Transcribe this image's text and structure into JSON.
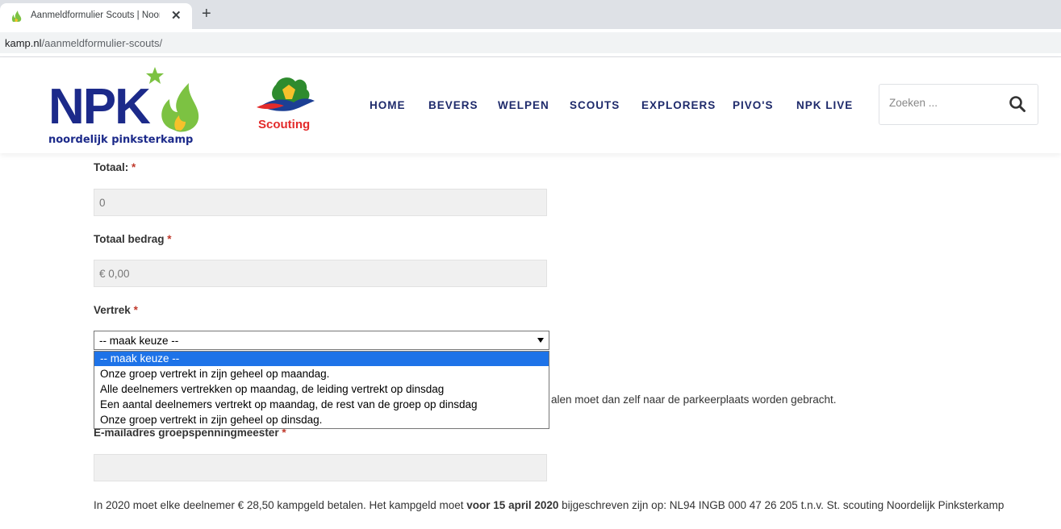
{
  "browser": {
    "tab_title": "Aanmeldformulier Scouts | Noord",
    "close_label": "✕",
    "new_tab_label": "+",
    "url_domain": "kamp.nl",
    "url_path": "/aanmeldformulier-scouts/"
  },
  "header": {
    "logo_text": "NPK",
    "logo_subtext": "noordelijk pinksterkamp",
    "scouting_logo_text": "Scouting",
    "nav": [
      "HOME",
      "BEVERS",
      "WELPEN",
      "SCOUTS",
      "EXPLORERS",
      "PIVO'S",
      "NPK LIVE"
    ],
    "search_placeholder": "Zoeken ..."
  },
  "form": {
    "totaal_label": "Totaal:",
    "totaal_value": "0",
    "bedrag_label": "Totaal bedrag",
    "bedrag_value": "€ 0,00",
    "vertrek_label": "Vertrek",
    "vertrek_selected": "-- maak keuze --",
    "vertrek_options": [
      "-- maak keuze --",
      "Onze groep vertrekt in zijn geheel op maandag.",
      "Alle deelnemers vertrekken op maandag, de leiding vertrekt op dinsdag",
      "Een aantal deelnemers vertrekt op maandag, de rest van de groep op dinsdag",
      "Onze groep vertrekt in zijn geheel op dinsdag."
    ],
    "hint_partial": "alen moet dan zelf naar de parkeerplaats worden gebracht.",
    "email_label": "E-mailadres groepspenningmeester",
    "email_value": "",
    "required_mark": "*"
  },
  "info": {
    "text_before": "In 2020 moet elke deelnemer € 28,50 kampgeld betalen. Het kampgeld moet ",
    "text_bold": "voor 15 april 2020",
    "text_after": " bijgeschreven zijn op: NL94 INGB 000 47 26 205 t.n.v. St. scouting Noordelijk Pinksterkamp"
  },
  "colors": {
    "nav": "#1e2a6b",
    "logo_blue": "#1c2a8a",
    "logo_green": "#7cc242",
    "selected_option": "#1e73e8"
  }
}
